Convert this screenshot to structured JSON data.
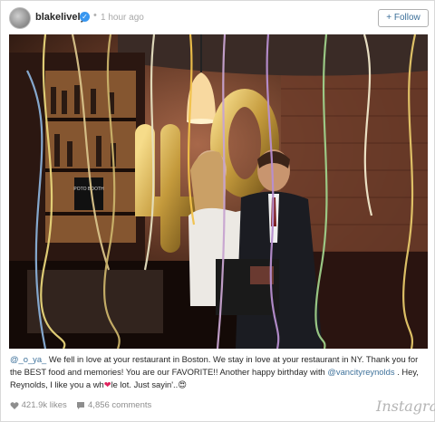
{
  "header": {
    "username": "blakelively",
    "separator": "•",
    "time_ago": "1 hour ago",
    "follow_label": "+ Follow"
  },
  "photo": {
    "shelf_sign": "POTO BOOTH"
  },
  "caption": {
    "mention_1": "@_o_ya_",
    "text_1": " We fell in love at your restaurant in Boston. We stay in love at your restaurant in NY. Thank you for the BEST food and memories! You are our FAVORITE!! Another happy birthday with ",
    "mention_2": "@vancityreynolds",
    "text_2": " . Hey, Reynolds, I like you a wh",
    "heart": "❤",
    "text_3": "le lot. Just sayin'..",
    "emoji": "😍"
  },
  "stats": {
    "likes": "421.9k likes",
    "comments": "4,856 comments"
  },
  "brand": "Instagram",
  "colors": {
    "link": "#3f729b",
    "verified": "#3897f0",
    "muted": "#8e8e8e"
  }
}
